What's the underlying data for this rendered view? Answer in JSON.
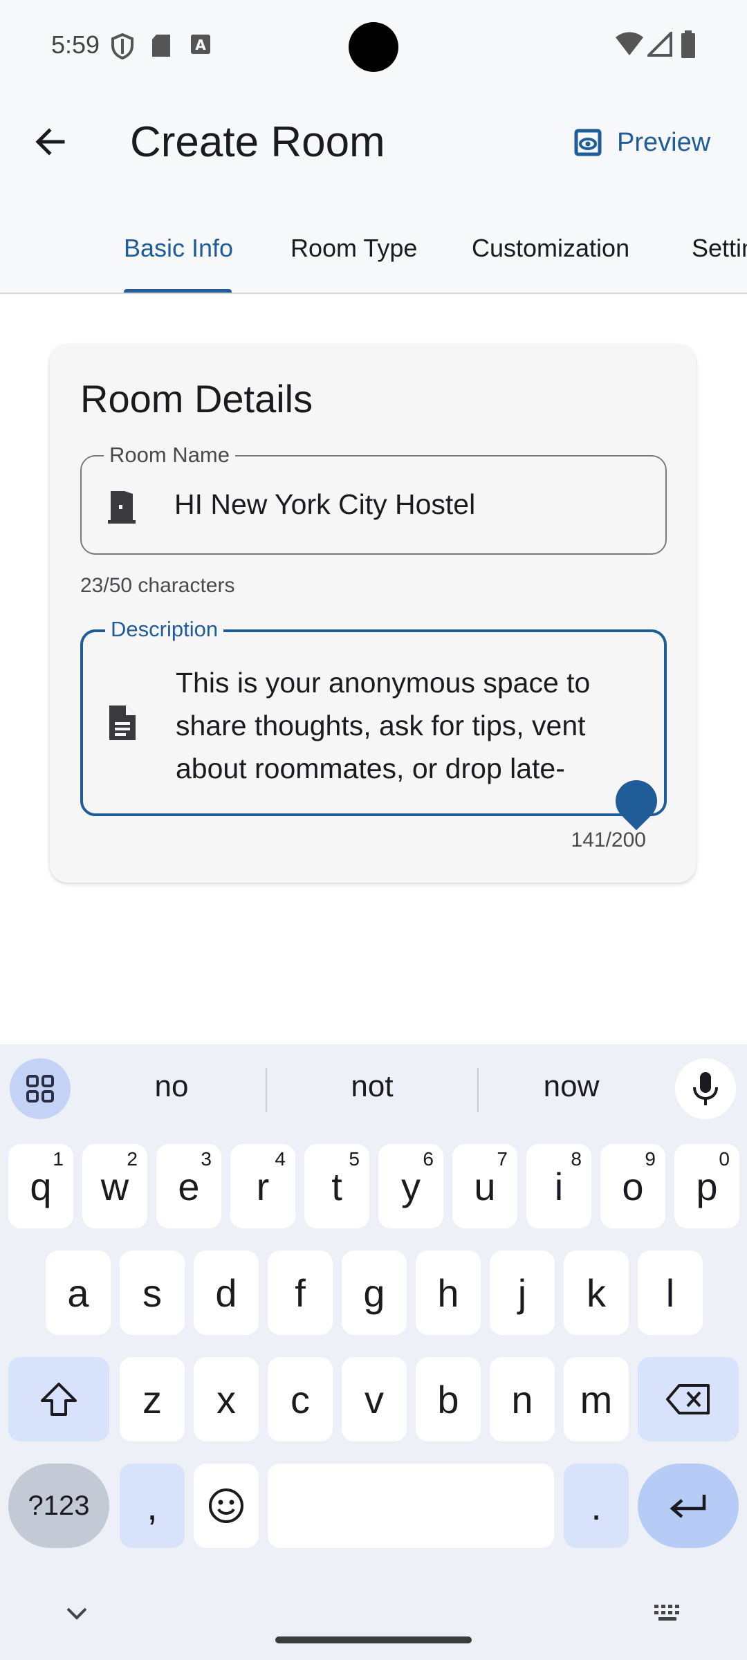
{
  "status_bar": {
    "time": "5:59"
  },
  "app_bar": {
    "title": "Create Room",
    "preview_label": "Preview"
  },
  "tabs": [
    {
      "label": "Basic Info",
      "active": true
    },
    {
      "label": "Room Type",
      "active": false
    },
    {
      "label": "Customization",
      "active": false
    },
    {
      "label": "Settings",
      "active": false
    }
  ],
  "card": {
    "title": "Room Details",
    "room_name": {
      "label": "Room Name",
      "value": "HI New York City Hostel",
      "helper": "23/50 characters"
    },
    "description": {
      "label": "Description",
      "value": "This is your anonymous space to share thoughts, ask for tips, vent about roommates, or drop late-",
      "counter": "141/200"
    }
  },
  "keyboard": {
    "suggestions": [
      "no",
      "not",
      "now"
    ],
    "row1": [
      {
        "k": "q",
        "h": "1"
      },
      {
        "k": "w",
        "h": "2"
      },
      {
        "k": "e",
        "h": "3"
      },
      {
        "k": "r",
        "h": "4"
      },
      {
        "k": "t",
        "h": "5"
      },
      {
        "k": "y",
        "h": "6"
      },
      {
        "k": "u",
        "h": "7"
      },
      {
        "k": "i",
        "h": "8"
      },
      {
        "k": "o",
        "h": "9"
      },
      {
        "k": "p",
        "h": "0"
      }
    ],
    "row2": [
      "a",
      "s",
      "d",
      "f",
      "g",
      "h",
      "j",
      "k",
      "l"
    ],
    "row3": [
      "z",
      "x",
      "c",
      "v",
      "b",
      "n",
      "m"
    ],
    "symbols_label": "?123",
    "comma": ",",
    "period": "."
  },
  "colors": {
    "accent": "#1f5c98",
    "surface": "#f7f8fa",
    "keyboard_bg": "#eef0f7"
  }
}
